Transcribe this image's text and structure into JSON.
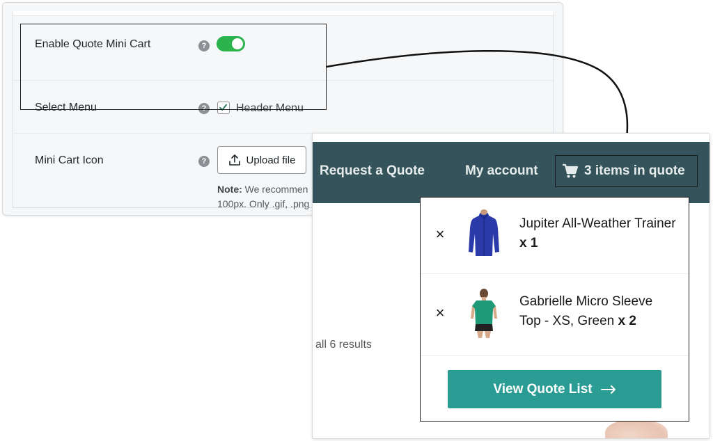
{
  "settings": {
    "enable_mini_cart": {
      "label": "Enable Quote Mini Cart",
      "help": "?",
      "enabled": true
    },
    "select_menu": {
      "label": "Select Menu",
      "help": "?",
      "option_label": "Header Menu",
      "checked": true
    },
    "mini_cart_icon": {
      "label": "Mini Cart Icon",
      "help": "?",
      "upload_label": "Upload file",
      "note_prefix": "Note:",
      "note_line1": " We recommen",
      "note_line2": "100px. Only .gif, .png"
    }
  },
  "store": {
    "nav": {
      "request_quote": "Request a Quote",
      "my_account": "My account",
      "cart_label": "3 items in quote"
    },
    "results_text": "all 6 results",
    "mini_cart": {
      "items": [
        {
          "name": "Jupiter All-Weather Trainer",
          "qty": "x 1",
          "image": "blue-jacket"
        },
        {
          "name": "Gabrielle Micro Sleeve Top - XS, Green",
          "qty": "x 2",
          "image": "green-top"
        }
      ],
      "button_label": "View Quote List"
    }
  },
  "colors": {
    "toggle_on": "#2bb34e",
    "nav_bg": "#35535a",
    "button_bg": "#2a9c93"
  },
  "icons": [
    "help-icon",
    "toggle-switch",
    "checkmark-icon",
    "upload-icon",
    "cart-icon",
    "close-icon",
    "arrow-right-icon"
  ]
}
